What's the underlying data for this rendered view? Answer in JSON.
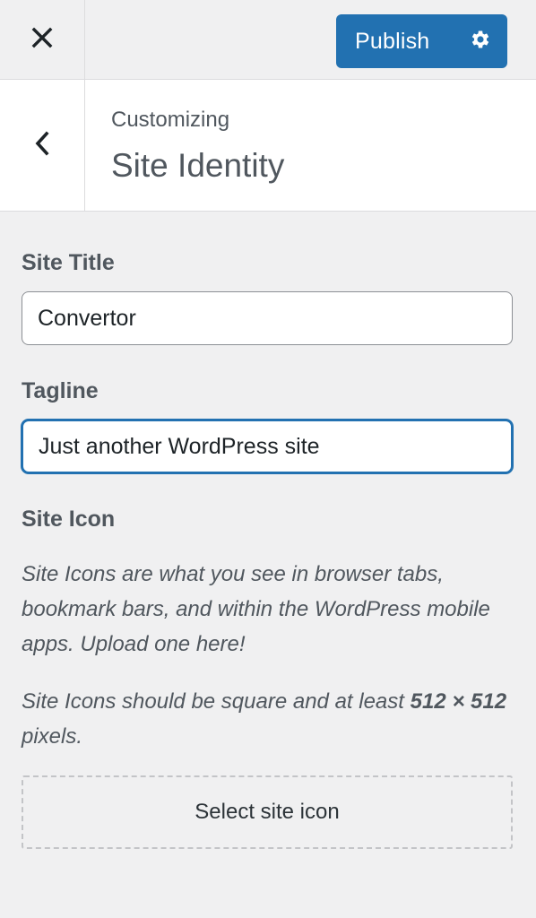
{
  "top_bar": {
    "close_icon": "close-icon",
    "publish_label": "Publish",
    "settings_icon": "gear-icon"
  },
  "section_header": {
    "back_icon": "chevron-left-icon",
    "subtitle": "Customizing",
    "title": "Site Identity"
  },
  "site_title": {
    "label": "Site Title",
    "value": "Convertor"
  },
  "tagline": {
    "label": "Tagline",
    "value": "Just another WordPress site"
  },
  "site_icon": {
    "label": "Site Icon",
    "description_1": "Site Icons are what you see in browser tabs, bookmark bars, and within the WordPress mobile apps. Upload one here!",
    "description_2_prefix": "Site Icons should be square and at least ",
    "description_2_size": "512 × 512",
    "description_2_suffix": " pixels.",
    "select_button": "Select site icon"
  },
  "colors": {
    "accent": "#2271b1",
    "background": "#f0f0f1",
    "text": "#1d2327",
    "muted_text": "#50575e",
    "border": "#8c8f94"
  }
}
